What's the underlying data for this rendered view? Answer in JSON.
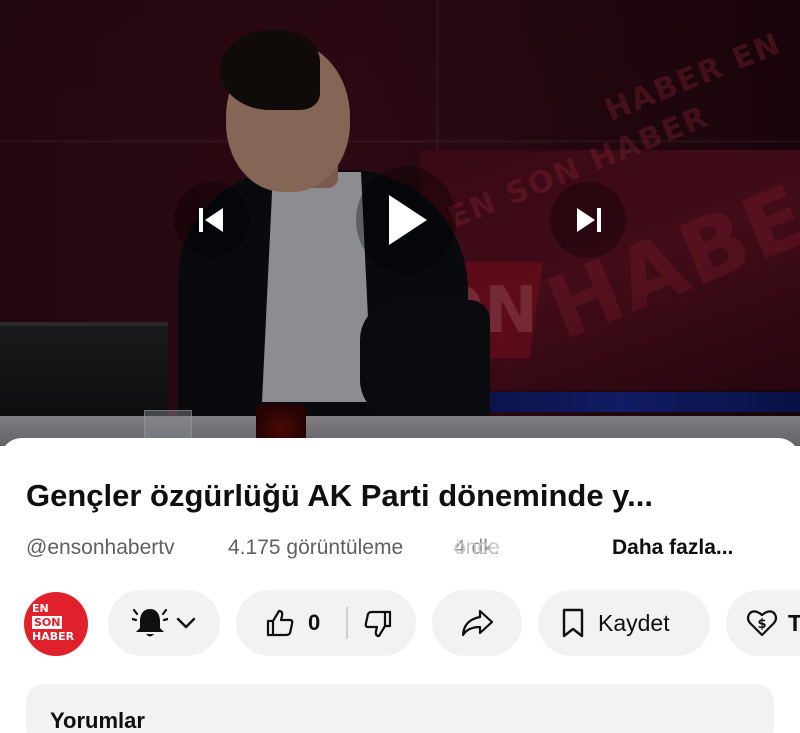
{
  "video": {
    "watermark": [
      "HABER EN",
      "EN SON HABER",
      "HABER",
      "ON"
    ],
    "controls": {
      "prev": "previous-track-icon",
      "play": "play-icon",
      "next": "next-track-icon"
    }
  },
  "info": {
    "title": "Gençler özgürlüğü AK Parti döneminde y...",
    "channel": "@ensonhabertv",
    "views": "4.175 görüntüleme",
    "time_visible": "4 dk. ",
    "time_faded": "önce",
    "more": "Daha fazla..."
  },
  "channel_avatar": {
    "line1": "EN",
    "line2": "SON",
    "line3": "HABER",
    "color": "#e0202a"
  },
  "actions": {
    "bell_icon": "bell-icon",
    "like_count": "0",
    "save_label": "Kaydet",
    "thanks_label": "T"
  },
  "comments": {
    "title": "Yorumlar"
  }
}
